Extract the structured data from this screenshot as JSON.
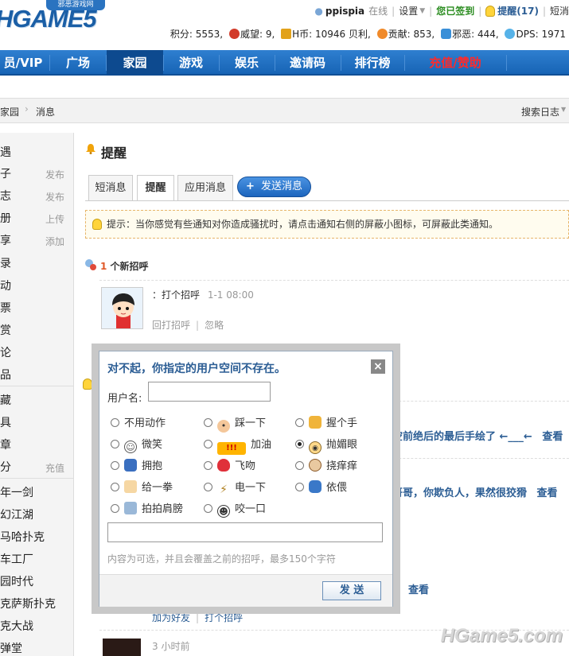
{
  "header": {
    "logo": "HGAME5",
    "logo_tag": "邪恶游戏网",
    "username": "ppispia",
    "online": "在线",
    "settings": "设置",
    "checkin": "您已签到",
    "remind": "提醒(17)",
    "shortmsg": "短消",
    "stats": {
      "points_label": "积分:",
      "points": "5553",
      "prestige_label": "威望:",
      "prestige": "9",
      "hcoin_label": "H币:",
      "hcoin": "10946 贝利",
      "contrib_label": "贡献:",
      "contrib": "853",
      "evil_label": "邪恶:",
      "evil": "444",
      "dps_label": "DPS:",
      "dps": "1971"
    }
  },
  "nav": {
    "items": [
      "员/VIP",
      "广场",
      "家园",
      "游戏",
      "娱乐",
      "邀请码",
      "排行榜",
      "充值/赞助"
    ],
    "active": "家园",
    "highlight_color": "#ff2a2a"
  },
  "breadcrumb": {
    "home": "家园",
    "current": "消息",
    "search": "搜索日志"
  },
  "sidebar": {
    "items": [
      {
        "label": "遇",
        "action": ""
      },
      {
        "label": "子",
        "action": "发布"
      },
      {
        "label": "志",
        "action": "发布"
      },
      {
        "label": "册",
        "action": "上传"
      },
      {
        "label": "享",
        "action": "添加"
      },
      {
        "label": "录",
        "action": ""
      },
      {
        "label": "动",
        "action": ""
      },
      {
        "label": "票",
        "action": ""
      },
      {
        "label": "赏",
        "action": ""
      },
      {
        "label": "论",
        "action": ""
      },
      {
        "label": "品",
        "action": ""
      },
      {
        "label": "藏",
        "action": ""
      },
      {
        "label": "具",
        "action": ""
      },
      {
        "label": "章",
        "action": ""
      },
      {
        "label": "分",
        "action": "充值"
      },
      {
        "label": "年一剑",
        "action": ""
      },
      {
        "label": "幻江湖",
        "action": ""
      },
      {
        "label": "马哈扑克",
        "action": ""
      },
      {
        "label": "车工厂",
        "action": ""
      },
      {
        "label": "园时代",
        "action": ""
      },
      {
        "label": "克萨斯扑克",
        "action": ""
      },
      {
        "label": "克大战",
        "action": ""
      },
      {
        "label": "弹堂",
        "action": ""
      }
    ]
  },
  "main": {
    "title": "提醒",
    "tabs": [
      "短消息",
      "提醒",
      "应用消息"
    ],
    "send_button": "发送消息",
    "tip": "提示：当你感觉有些通知对你造成骚扰时，请点击通知右侧的屏蔽小图标，可屏蔽此类通知。",
    "greet_count": "1",
    "greet_header": "个新招呼",
    "greet_text": "：打个招呼",
    "greet_time": "1-1 08:00",
    "reply": "回打招呼",
    "ignore": "忽略",
    "bg_line1": "空前绝后的最后手绘了 ←___←",
    "view1": "查看",
    "bg_line2": "哥哥，你欺负人，果然很狡猾",
    "view2": "查看",
    "view3": "查看",
    "add_friend": "加为好友",
    "greet2": "打个招呼",
    "time3": "3 小时前"
  },
  "dialog": {
    "title": "对不起，你指定的用户空间不存在。",
    "username_label": "用户名:",
    "username_value": "",
    "options": [
      {
        "label": "不用动作",
        "icon": "none",
        "selected": false
      },
      {
        "label": "踩一下",
        "icon": "footprint-icon",
        "selected": false
      },
      {
        "label": "握个手",
        "icon": "handshake-icon",
        "selected": false
      },
      {
        "label": "微笑",
        "icon": "smile-icon",
        "selected": false
      },
      {
        "label": "加油",
        "icon": "cheer-icon",
        "selected": false
      },
      {
        "label": "抛媚眼",
        "icon": "wink-icon",
        "selected": true
      },
      {
        "label": "拥抱",
        "icon": "hug-icon",
        "selected": false
      },
      {
        "label": "飞吻",
        "icon": "kiss-icon",
        "selected": false
      },
      {
        "label": "挠痒痒",
        "icon": "tickle-icon",
        "selected": false
      },
      {
        "label": "给一拳",
        "icon": "punch-icon",
        "selected": false
      },
      {
        "label": "电一下",
        "icon": "lightning-icon",
        "selected": false
      },
      {
        "label": "依偎",
        "icon": "cuddle-icon",
        "selected": false
      },
      {
        "label": "拍拍肩膀",
        "icon": "pat-icon",
        "selected": false
      },
      {
        "label": "咬一口",
        "icon": "bite-icon",
        "selected": false
      }
    ],
    "message_value": "",
    "hint": "内容为可选，并且会覆盖之前的招呼，最多150个字符",
    "send": "发 送"
  },
  "watermark": "HGame5.com"
}
